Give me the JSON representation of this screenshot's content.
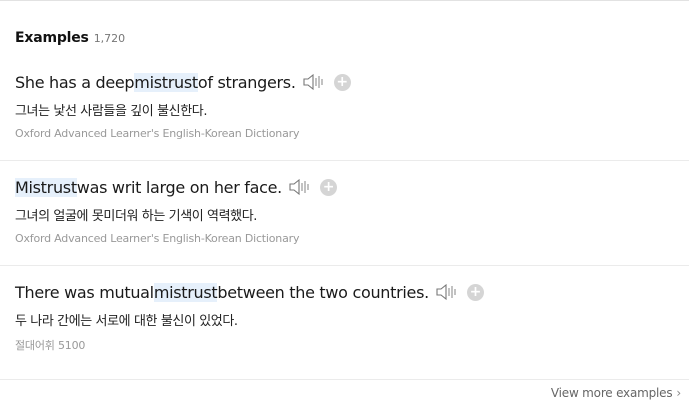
{
  "examples": {
    "title": "Examples",
    "count": "1,720",
    "items": [
      {
        "en_before": "She has a deep ",
        "en_highlight": "mistrust",
        "en_after": " of strangers.",
        "ko": "그녀는 낯선 사람들을 깊이 불신한다.",
        "source": "Oxford Advanced Learner's English-Korean Dictionary"
      },
      {
        "en_before": "",
        "en_highlight": "Mistrust",
        "en_after": " was writ large on her face.",
        "ko": "그녀의 얼굴에 못미더워 하는 기색이 역력했다.",
        "source": "Oxford Advanced Learner's English-Korean Dictionary"
      },
      {
        "en_before": "There was mutual ",
        "en_highlight": "mistrust",
        "en_after": " between the two countries.",
        "ko": "두 나라 간에는 서로에 대한 불신이 있었다.",
        "source": "절대어휘 5100"
      }
    ],
    "add_symbol": "+",
    "speaker_icon": "speaker-icon",
    "add_icon": "plus-circle-icon"
  },
  "view_more": {
    "label": "View more examples",
    "chevron": "›"
  },
  "colors": {
    "highlight": "#e6f0fb",
    "source_text": "#999999",
    "add_button": "#d5d5d5"
  }
}
